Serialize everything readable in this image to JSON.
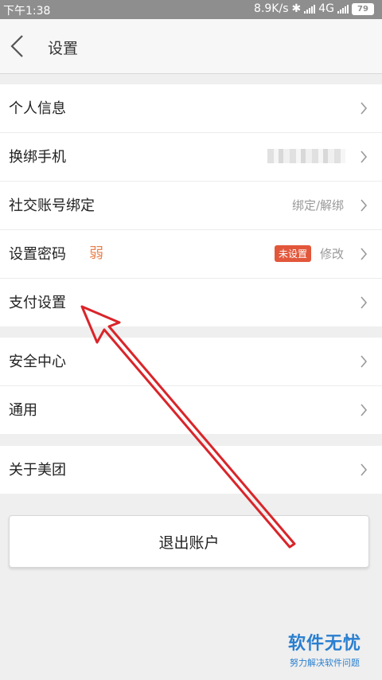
{
  "status_bar": {
    "time": "下午1:38",
    "net_speed": "8.9K/s",
    "network": "4G",
    "battery": "79"
  },
  "header": {
    "title": "设置"
  },
  "groups": [
    {
      "items": [
        {
          "label": "个人信息"
        },
        {
          "label": "换绑手机"
        },
        {
          "label": "社交账号绑定",
          "value": "绑定/解绑"
        },
        {
          "label": "设置密码",
          "tag": "弱",
          "badge": "未设置",
          "value": "修改"
        },
        {
          "label": "支付设置"
        }
      ]
    },
    {
      "items": [
        {
          "label": "安全中心"
        },
        {
          "label": "通用"
        }
      ]
    },
    {
      "items": [
        {
          "label": "关于美团"
        }
      ]
    }
  ],
  "logout_label": "退出账户",
  "watermark": {
    "title": "软件无忧",
    "subtitle": "努力解决软件问题"
  },
  "colors": {
    "weak_text": "#e8834f",
    "badge_bg": "#e2573b",
    "annotation_arrow": "#d9252a",
    "watermark": "#2a7fd0"
  }
}
